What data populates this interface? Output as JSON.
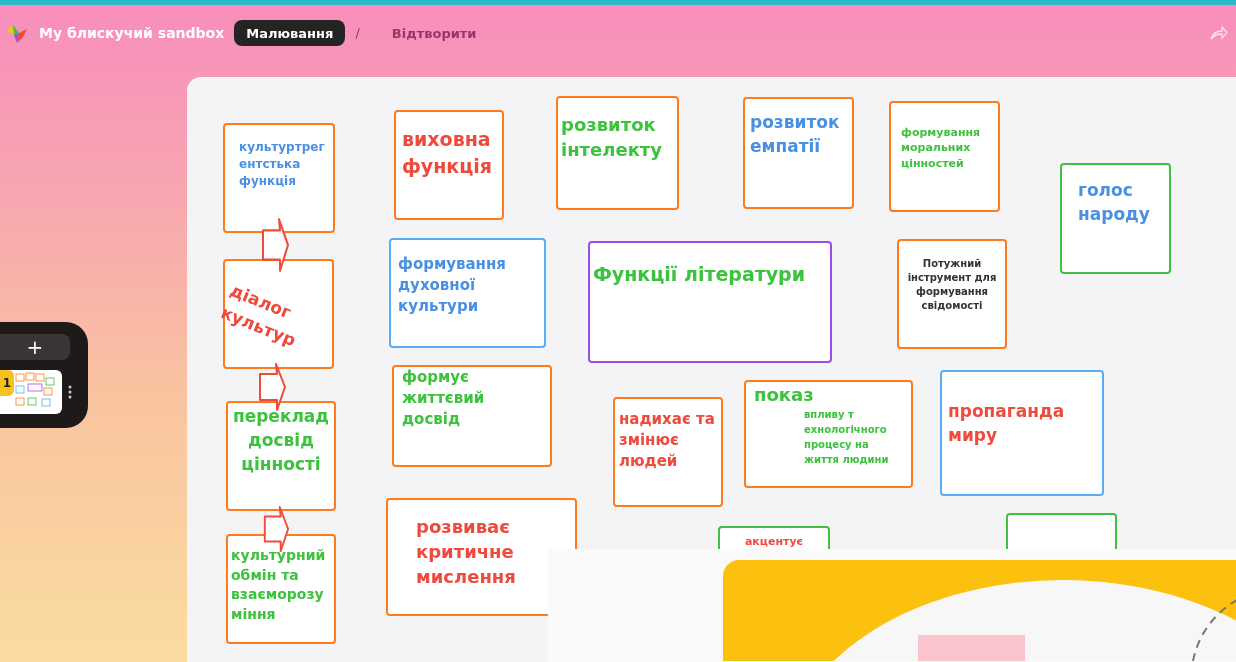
{
  "header": {
    "title": "My блискучий sandbox",
    "tabs": [
      {
        "label": "Малювання",
        "selected": true
      },
      {
        "label": "Відтворити",
        "selected": false
      }
    ],
    "separator": "/"
  },
  "slides_panel": {
    "add_button": "+",
    "slides": [
      {
        "number": "1"
      }
    ]
  },
  "notes": [
    {
      "color": "#ff7a1a",
      "label": {
        "text": "культуртрегентстька функція",
        "color": "#4a90e2"
      }
    },
    {
      "color": "#ff7a1a",
      "label": {
        "text": "виховна функція",
        "color": "#ef4a3c"
      }
    },
    {
      "color": "#ff7a1a",
      "label": {
        "text": "розвиток інтелекту",
        "color": "#3cc23c"
      }
    },
    {
      "color": "#ff7a1a",
      "label": {
        "text": "розвиток емпатії",
        "color": "#4a90e2"
      }
    },
    {
      "color": "#ff7a1a",
      "label": {
        "text": "формування моральних цінностей",
        "color": "#3cc23c"
      }
    },
    {
      "color": "#3cc23c",
      "label": {
        "text": "голос народу",
        "color": "#4a90e2"
      }
    },
    {
      "color": "#ff7a1a",
      "label": {
        "text": "діалог культур",
        "color": "#ef4a3c"
      }
    },
    {
      "color": "#5aacf5",
      "label": {
        "text": "формування духовної культури",
        "color": "#4a90e2"
      }
    },
    {
      "color": "#9b4dea",
      "label": {
        "text": "Функції літератури",
        "color": "#3cc23c"
      }
    },
    {
      "color": "#ff7a1a",
      "label": {
        "text": "Потужний інструмент для формування свідомості",
        "color": "#333333"
      }
    },
    {
      "color": "#ff7a1a",
      "label": {
        "text": "переклад досвід цінності",
        "color": "#3cc23c"
      }
    },
    {
      "color": "#ff7a1a",
      "label": {
        "text": "формує життєвий досвід",
        "color": "#3cc23c"
      }
    },
    {
      "color": "#ff7a1a",
      "label": {
        "text": "надихає та змінює людей",
        "color": "#ef4a3c"
      }
    },
    {
      "color": "#ff7a1a",
      "title": {
        "text": "показ",
        "color": "#3cc23c"
      },
      "label": {
        "text": "впливу т ехнологічного процесу на життя людини",
        "color": "#3cc23c"
      }
    },
    {
      "color": "#5aacf5",
      "label": {
        "text": "пропаганда миру",
        "color": "#ef4a3c"
      }
    },
    {
      "color": "#ff7a1a",
      "label": {
        "text": "культурний обмін та взаєморозуміння",
        "color": "#3cc23c"
      }
    },
    {
      "color": "#ff7a1a",
      "label": {
        "text": "розвиває критичне мислення",
        "color": "#ef4a3c"
      }
    },
    {
      "color": "#3cc23c",
      "label": {
        "text": "акцентує",
        "color": "#ef4a3c"
      }
    },
    {
      "color": "#3cc23c"
    }
  ]
}
